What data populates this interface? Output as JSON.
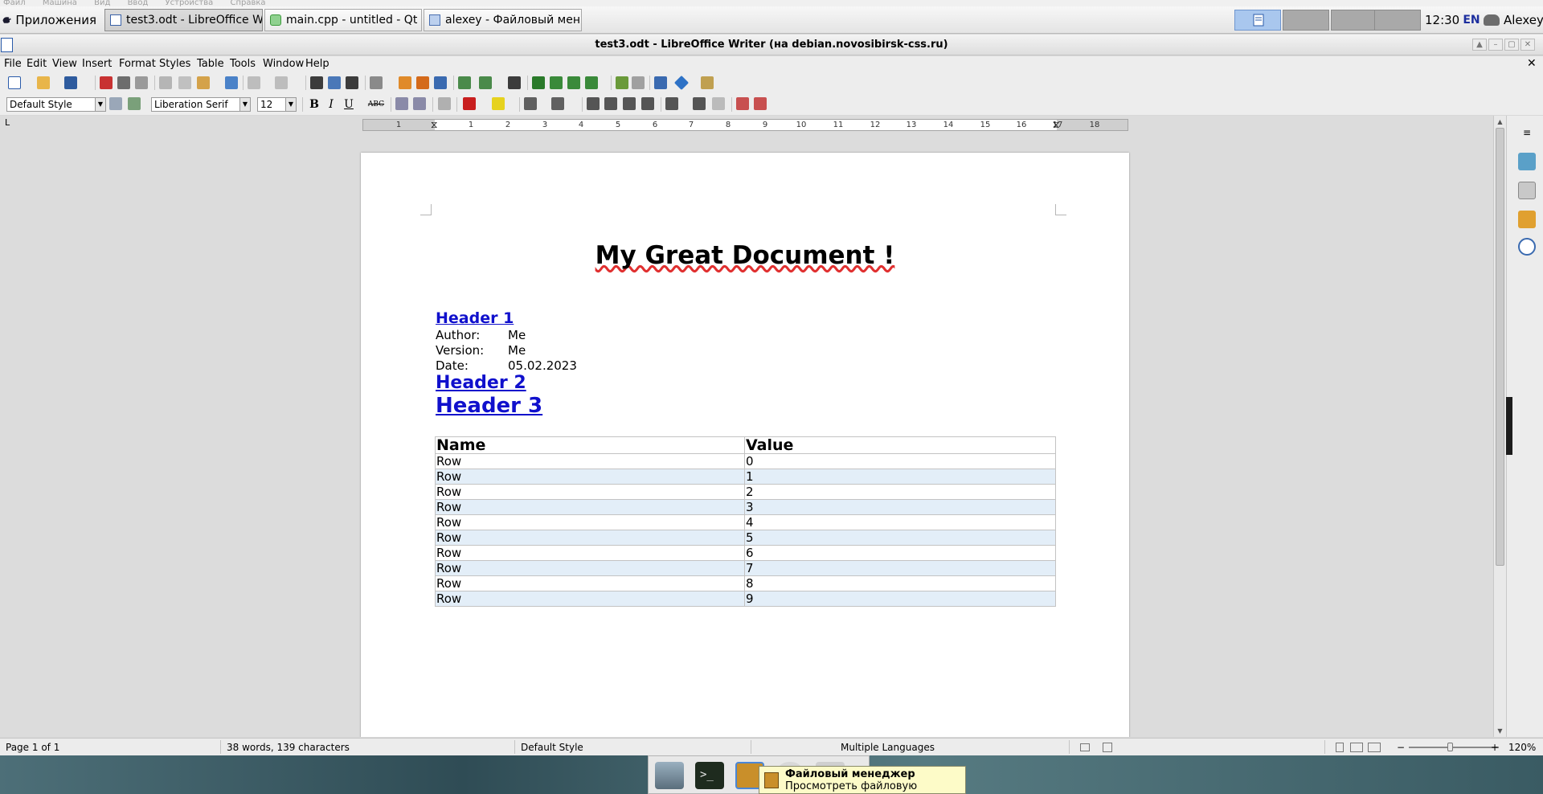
{
  "host_menu": [
    "Файл",
    "Машина",
    "Вид",
    "Ввод",
    "Устройства",
    "Справка"
  ],
  "panel": {
    "apps_label": "Приложения",
    "tasks": [
      {
        "label": "test3.odt - LibreOffice W..."
      },
      {
        "label": "main.cpp - untitled - Qt ..."
      },
      {
        "label": "alexey - Файловый мен..."
      }
    ],
    "clock": "12:30",
    "lang": "EN",
    "user": "Alexey"
  },
  "window": {
    "title": "test3.odt - LibreOffice Writer (на debian.novosibirsk-css.ru)"
  },
  "menubar": [
    "File",
    "Edit",
    "View",
    "Insert",
    "Format",
    "Styles",
    "Table",
    "Tools",
    "Window",
    "Help"
  ],
  "format_bar": {
    "paragraph_style": "Default Style",
    "font_name": "Liberation Serif",
    "font_size": "12",
    "bold": "B",
    "italic": "I",
    "underline": "U",
    "strike": "ABC"
  },
  "ruler": {
    "ticks": [
      "1",
      "1",
      "2",
      "3",
      "4",
      "5",
      "6",
      "7",
      "8",
      "9",
      "10",
      "11",
      "12",
      "13",
      "14",
      "15",
      "16",
      "17",
      "18"
    ]
  },
  "document": {
    "title": "My Great Document !",
    "header1": "Header 1",
    "header2": "Header 2",
    "header3": "Header 3",
    "meta": [
      {
        "label": "Author:",
        "value": "Me"
      },
      {
        "label": "Version:",
        "value": "Me"
      },
      {
        "label": "Date:",
        "value": "05.02.2023"
      }
    ],
    "table": {
      "headers": [
        "Name",
        "Value"
      ],
      "rows": [
        [
          "Row",
          "0"
        ],
        [
          "Row",
          "1"
        ],
        [
          "Row",
          "2"
        ],
        [
          "Row",
          "3"
        ],
        [
          "Row",
          "4"
        ],
        [
          "Row",
          "5"
        ],
        [
          "Row",
          "6"
        ],
        [
          "Row",
          "7"
        ],
        [
          "Row",
          "8"
        ],
        [
          "Row",
          "9"
        ]
      ]
    }
  },
  "statusbar": {
    "page": "Page 1 of 1",
    "words": "38 words, 139 characters",
    "style": "Default Style",
    "language": "Multiple Languages",
    "zoom": "120%"
  },
  "tooltip": {
    "title": "Файловый менеджер",
    "text": "Просмотреть файловую систему"
  },
  "colors": {
    "hyperlink": "#1010cc",
    "selection": "#e3eef8",
    "pager_active": "#a9c7ee"
  }
}
